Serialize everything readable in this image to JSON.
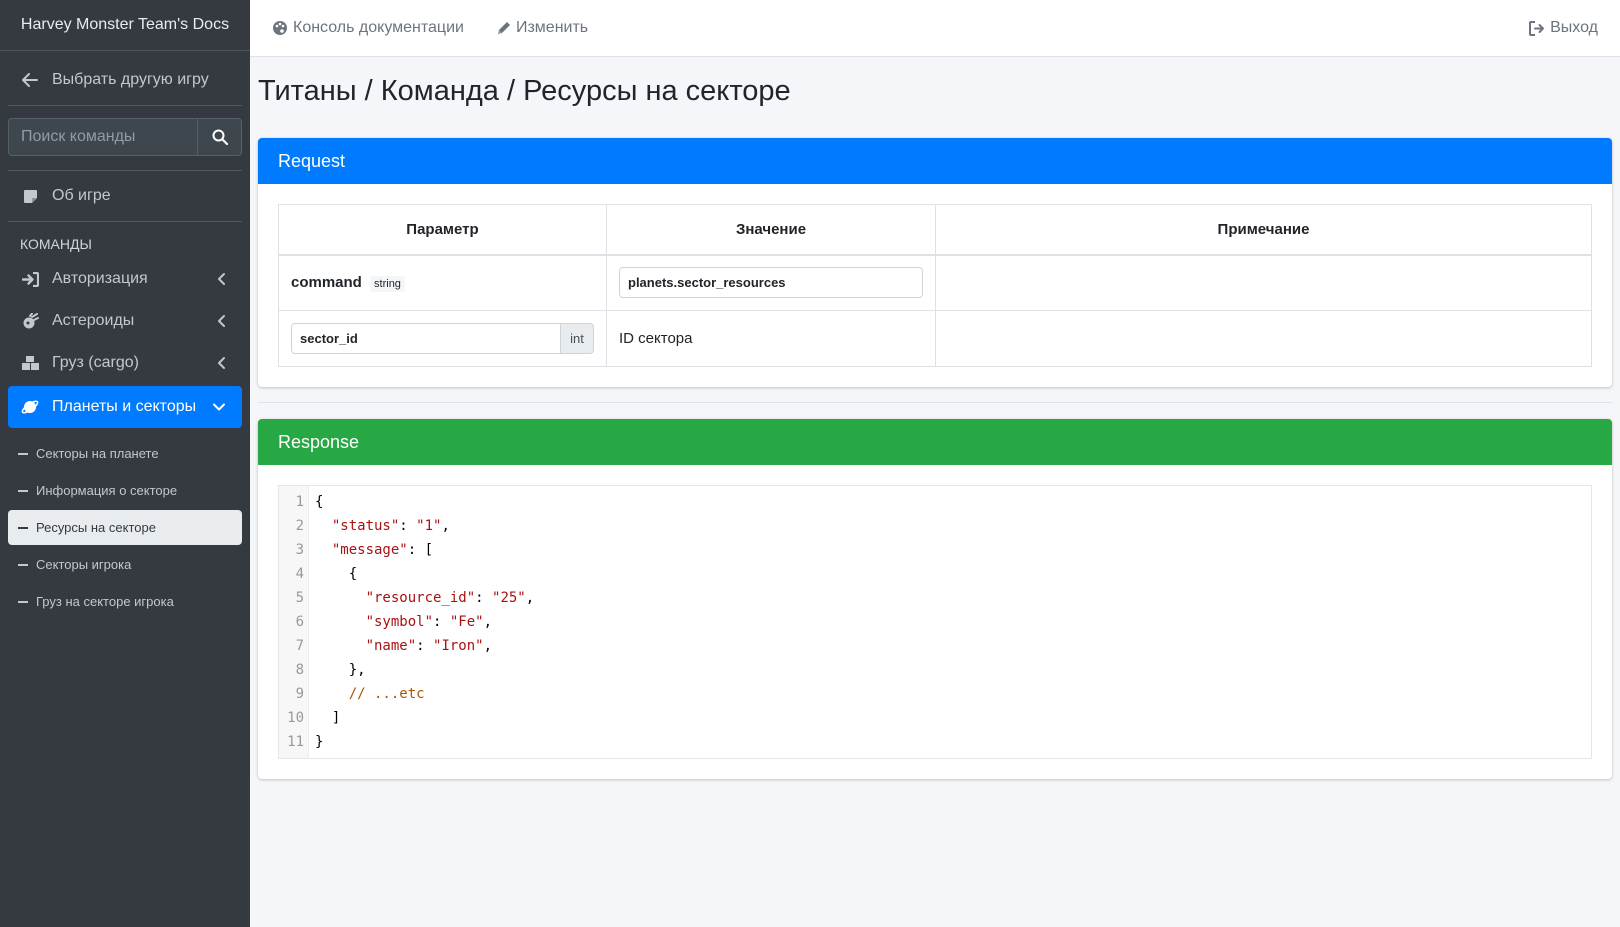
{
  "sidebar": {
    "brand": "Harvey Monster Team's Docs",
    "back_label": "Выбрать другую игру",
    "search_placeholder": "Поиск команды",
    "about_label": "Об игре",
    "header": "КОМАНДЫ",
    "items": [
      {
        "label": "Авторизация",
        "icon": "sign-in-icon"
      },
      {
        "label": "Астероиды",
        "icon": "meteor-icon"
      },
      {
        "label": "Груз (cargo)",
        "icon": "boxes-icon"
      },
      {
        "label": "Планеты и секторы",
        "icon": "globe-icon",
        "active": true
      }
    ],
    "subitems": [
      {
        "label": "Секторы на планете"
      },
      {
        "label": "Информация о секторе"
      },
      {
        "label": "Ресурсы на секторе",
        "active": true
      },
      {
        "label": "Секторы игрока"
      },
      {
        "label": "Груз на секторе игрока"
      }
    ]
  },
  "topbar": {
    "console_label": "Консоль документации",
    "edit_label": "Изменить",
    "logout_label": "Выход"
  },
  "page": {
    "title": "Титаны / Команда / Ресурсы на секторе"
  },
  "request": {
    "header": "Request",
    "columns": [
      "Параметр",
      "Значение",
      "Примечание"
    ],
    "command": {
      "name": "command",
      "type": "string",
      "value": "planets.sector_resources",
      "note": ""
    },
    "param": {
      "name": "sector_id",
      "type": "int",
      "value": "ID сектора",
      "note": ""
    }
  },
  "response": {
    "header": "Response",
    "line_numbers": [
      "1",
      "2",
      "3",
      "4",
      "5",
      "6",
      "7",
      "8",
      "9",
      "10",
      "11"
    ],
    "lines": [
      "{",
      "  \"status\": \"1\",",
      "  \"message\": [",
      "    {",
      "      \"resource_id\": \"25\",",
      "      \"symbol\": \"Fe\",",
      "      \"name\": \"Iron\",",
      "    },",
      "    // ...etc",
      "  ]",
      "}"
    ]
  },
  "colors": {
    "sidebar_bg": "#343a40",
    "primary": "#007bff",
    "success": "#28a745"
  }
}
